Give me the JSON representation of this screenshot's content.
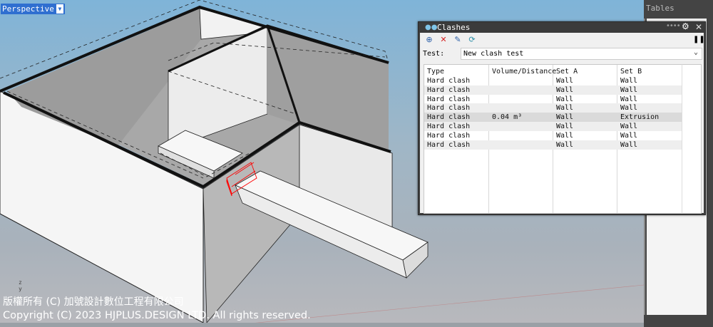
{
  "viewport": {
    "label": "Perspective",
    "dropdown_icon": "triangle-down-icon",
    "axis_label": "z\ny",
    "copyright_cn": "版權所有 (C) 加號設計數位工程有限公司",
    "copyright_en": "Copyright (C) 2023 HJPLUS.DESIGN LTD. All rights reserved."
  },
  "right_panel": {
    "title": "Tables"
  },
  "clashes": {
    "title": "Clashes",
    "toolbar": [
      {
        "icon": "add-clash-test-icon"
      },
      {
        "icon": "delete-icon"
      },
      {
        "icon": "edit-clash-test-icon"
      },
      {
        "icon": "run-clash-icon"
      }
    ],
    "test_label": "Test:",
    "test_value": "New clash test",
    "columns": [
      "Type",
      "Volume/Distance",
      "Set A",
      "Set B"
    ],
    "rows": [
      {
        "type": "Hard clash",
        "volume": "",
        "set_a": "Wall",
        "set_b": "Wall"
      },
      {
        "type": "Hard clash",
        "volume": "",
        "set_a": "Wall",
        "set_b": "Wall"
      },
      {
        "type": "Hard clash",
        "volume": "",
        "set_a": "Wall",
        "set_b": "Wall"
      },
      {
        "type": "Hard clash",
        "volume": "",
        "set_a": "Wall",
        "set_b": "Wall"
      },
      {
        "type": "Hard clash",
        "volume": "0.04 m³",
        "set_a": "Wall",
        "set_b": "Extrusion"
      },
      {
        "type": "Hard clash",
        "volume": "",
        "set_a": "Wall",
        "set_b": "Wall"
      },
      {
        "type": "Hard clash",
        "volume": "",
        "set_a": "Wall",
        "set_b": "Wall"
      },
      {
        "type": "Hard clash",
        "volume": "",
        "set_a": "Wall",
        "set_b": "Wall"
      }
    ],
    "selected_row": 4,
    "colors": {
      "selected": "#dadada",
      "alt": "#eeeeee",
      "accent": "#2f6fd0",
      "clash_highlight": "#ff0000"
    }
  }
}
